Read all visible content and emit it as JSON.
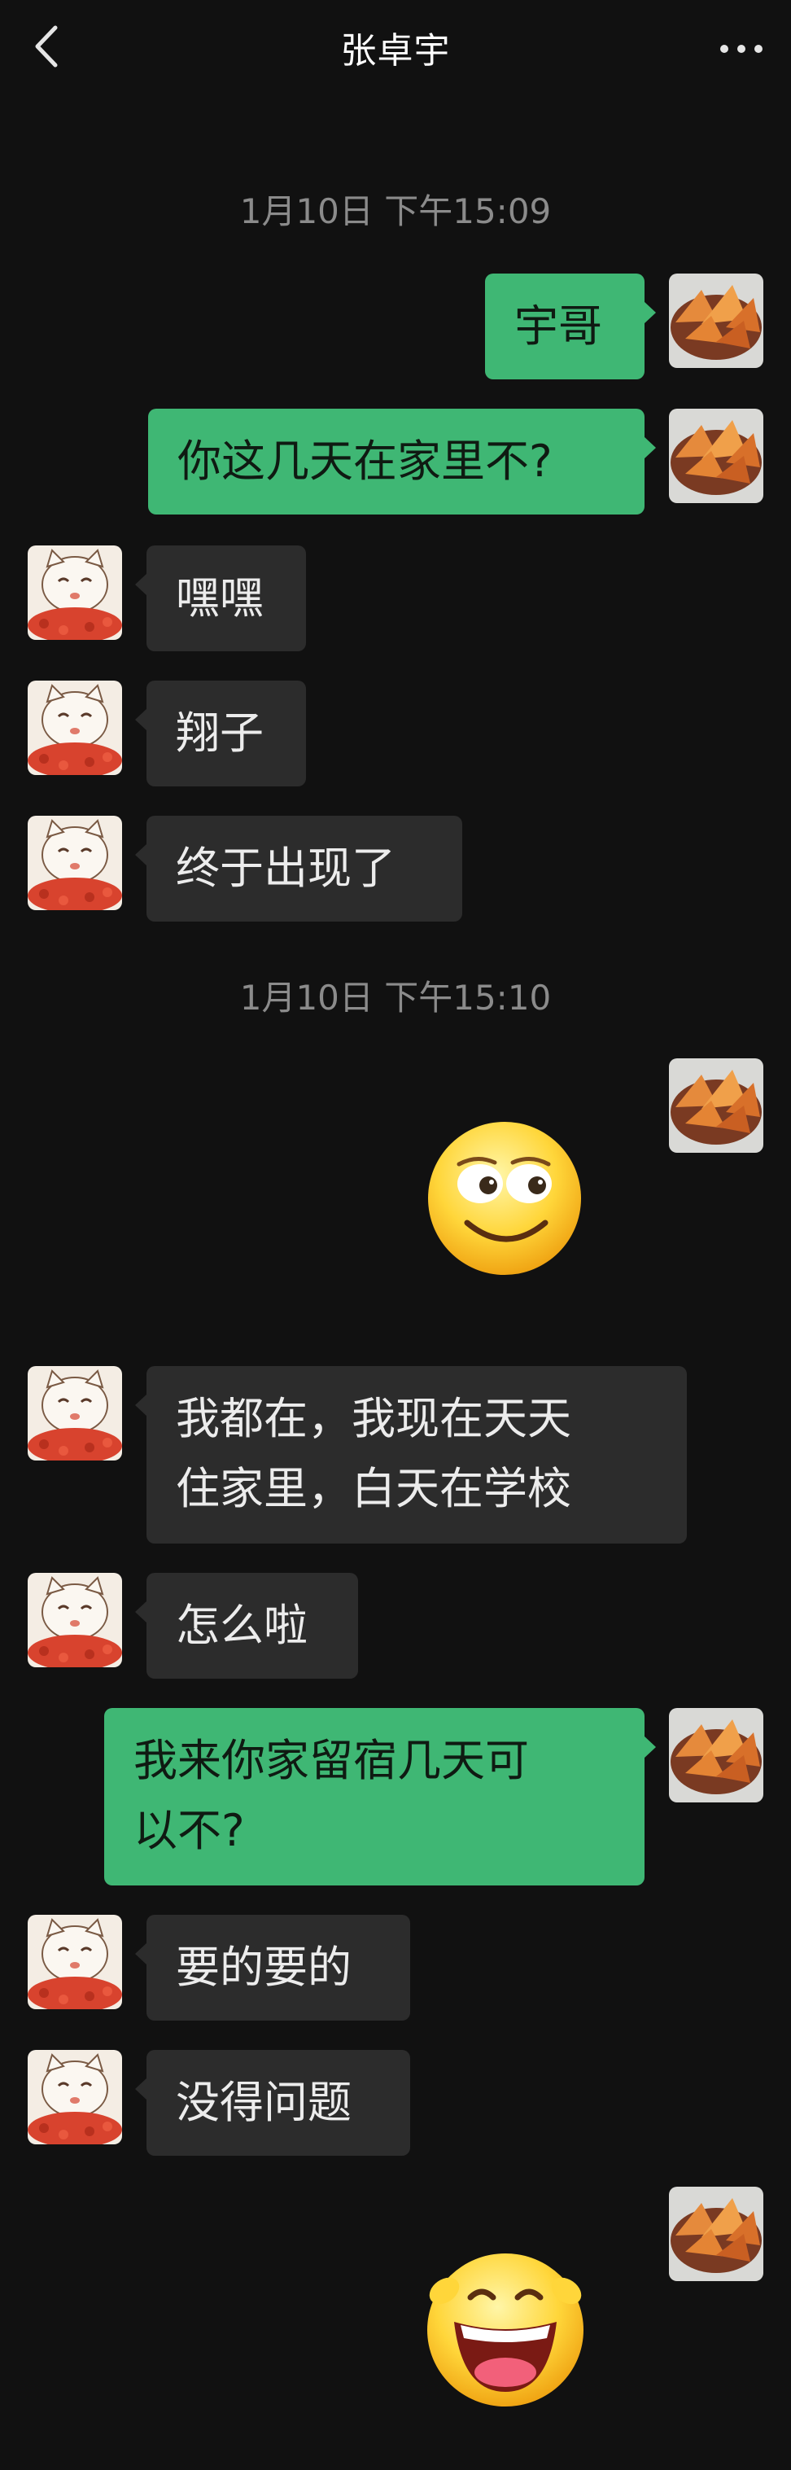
{
  "header": {
    "title": "张卓宇",
    "back_icon": "chevron-left-icon",
    "more_icon": "more-dots-icon"
  },
  "timestamps": [
    "1月10日 下午15:09",
    "1月10日 下午15:10"
  ],
  "messages": [
    {
      "from": "me",
      "text": "宇哥"
    },
    {
      "from": "me",
      "text": "你这几天在家里不?"
    },
    {
      "from": "contact",
      "text": "嘿嘿"
    },
    {
      "from": "contact",
      "text": "翔子"
    },
    {
      "from": "contact",
      "text": "终于出现了"
    },
    {
      "from": "me",
      "sticker": "sly-smile-emoji"
    },
    {
      "from": "contact",
      "lines": [
        "我都在，我现在天天",
        "住家里，白天在学校"
      ]
    },
    {
      "from": "contact",
      "text": "怎么啦"
    },
    {
      "from": "me",
      "lines": [
        "我来你家留宿几天可",
        "以不?"
      ]
    },
    {
      "from": "contact",
      "text": "要的要的"
    },
    {
      "from": "contact",
      "text": "没得问题"
    },
    {
      "from": "me",
      "sticker": "laughing-emoji"
    }
  ],
  "colors": {
    "background": "#111111",
    "outgoing_bubble": "#3fb774",
    "incoming_bubble": "#2c2c2c",
    "timestamp_text": "#8b8b8b"
  }
}
